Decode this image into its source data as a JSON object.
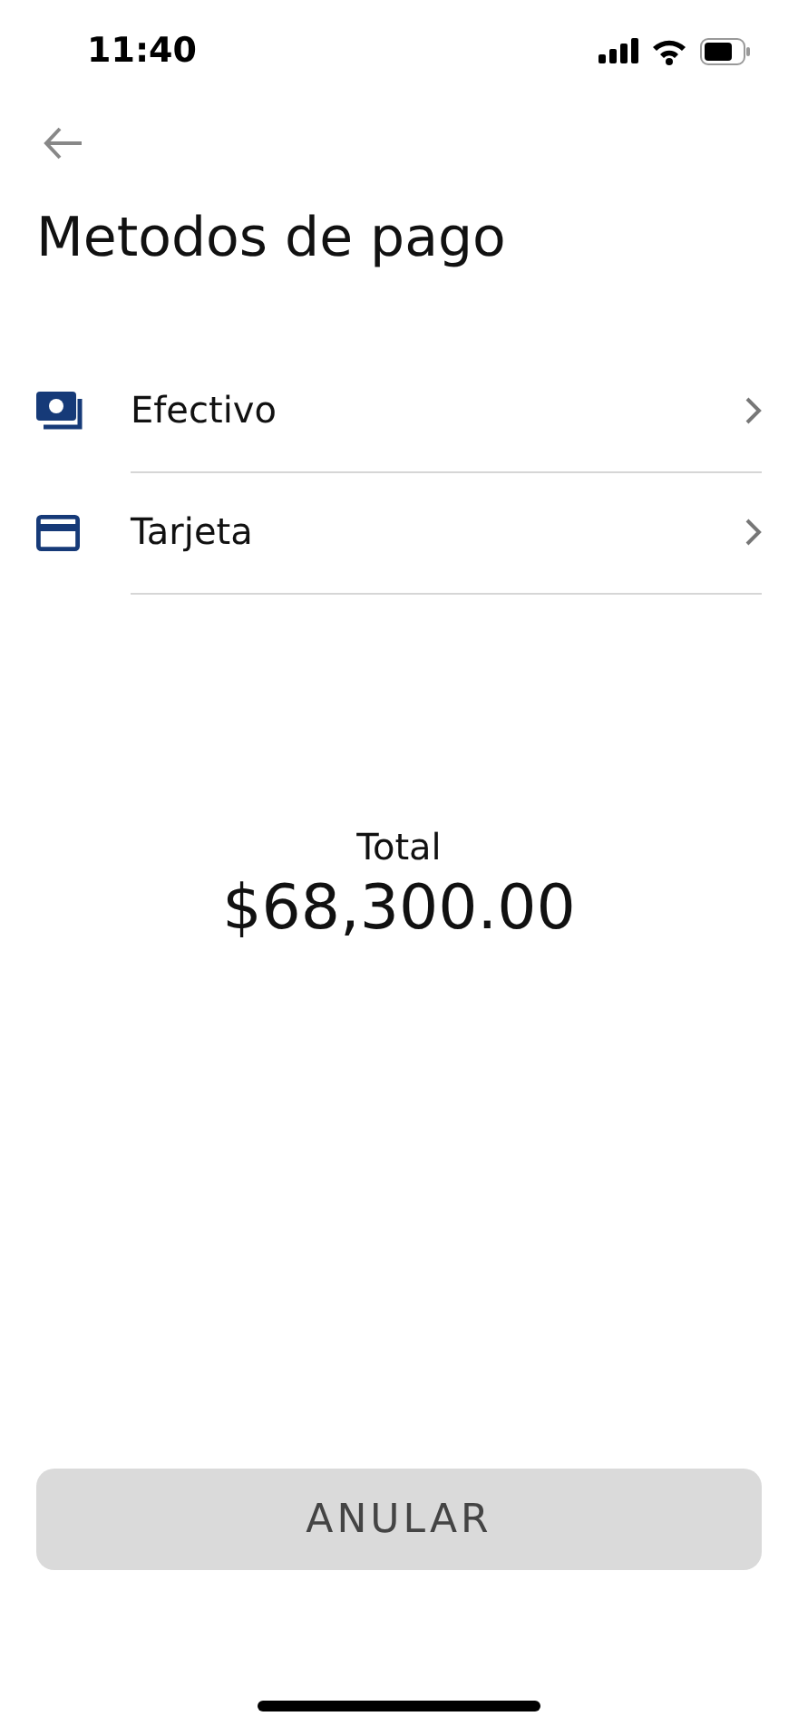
{
  "status_bar": {
    "time": "11:40"
  },
  "title": "Metodos de pago",
  "payment_methods": [
    {
      "kind": "cash",
      "label": "Efectivo"
    },
    {
      "kind": "card",
      "label": "Tarjeta"
    }
  ],
  "total": {
    "label": "Total",
    "amount": "$68,300.00"
  },
  "cancel_button": {
    "label": "ANULAR",
    "disabled": true
  }
}
